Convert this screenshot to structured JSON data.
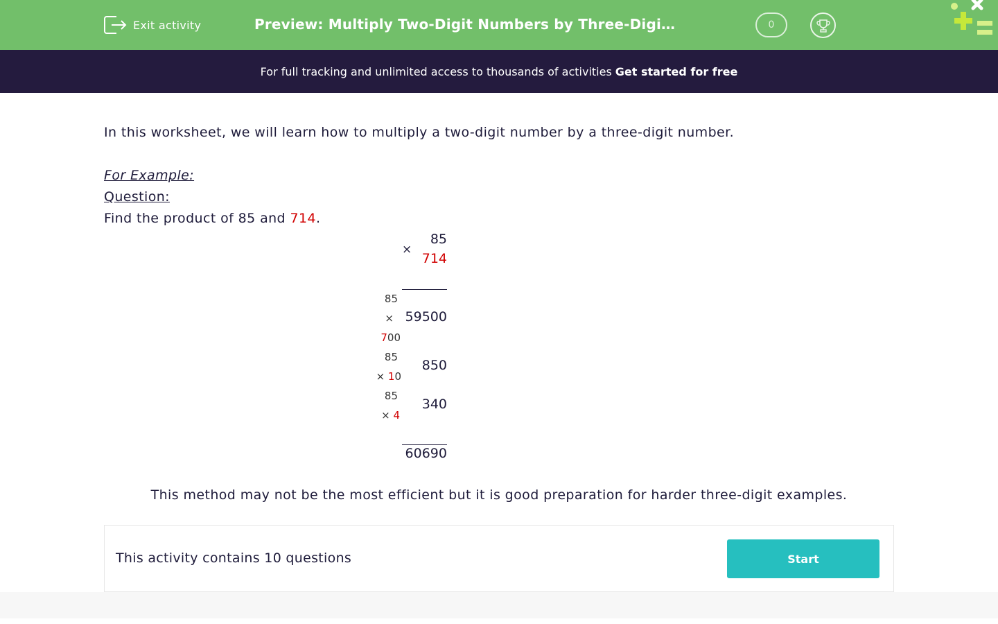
{
  "header": {
    "exit_label": "Exit activity",
    "title": "Preview: Multiply Two-Digit Numbers by Three-Digit Numbers",
    "score": "0",
    "exit_icon": "exit-icon",
    "trophy_icon": "trophy-icon",
    "logo": "nagwa-style-logo"
  },
  "promo": {
    "text": "For full tracking and unlimited access to thousands of activities",
    "cta": "Get started for free"
  },
  "lesson": {
    "intro": "In this worksheet, we will learn how to multiply a two-digit number by a three-digit number.",
    "example_label": "For Example:",
    "question_label": "Question:",
    "question_prefix": "Find the product of 85 and ",
    "question_highlight": "714",
    "question_suffix": "."
  },
  "calculation": {
    "times_sign": "×",
    "top_number": "85",
    "bottom_number": "714",
    "rows": [
      {
        "left_top": "85",
        "left_mid": "×",
        "left_bottom_red": "7",
        "left_bottom_rest": "00",
        "result": "59500"
      },
      {
        "left_top": "85",
        "left_mid_prefix": "× ",
        "left_mid_red": "1",
        "left_mid_rest": "0",
        "result": "850"
      },
      {
        "left_top": "85",
        "left_mid_prefix": "× ",
        "left_mid_red": "4",
        "left_mid_rest": "",
        "result": "340"
      }
    ],
    "total": "60690"
  },
  "closing": "This method may not be the most efficient but it is good preparation for harder three-digit examples.",
  "activity": {
    "text": "This activity contains 10 questions",
    "start_label": "Start"
  },
  "colors": {
    "header_green": "#72bf6a",
    "promo_navy": "#241b3e",
    "highlight_red": "#d10000",
    "start_teal": "#26bfbf"
  }
}
